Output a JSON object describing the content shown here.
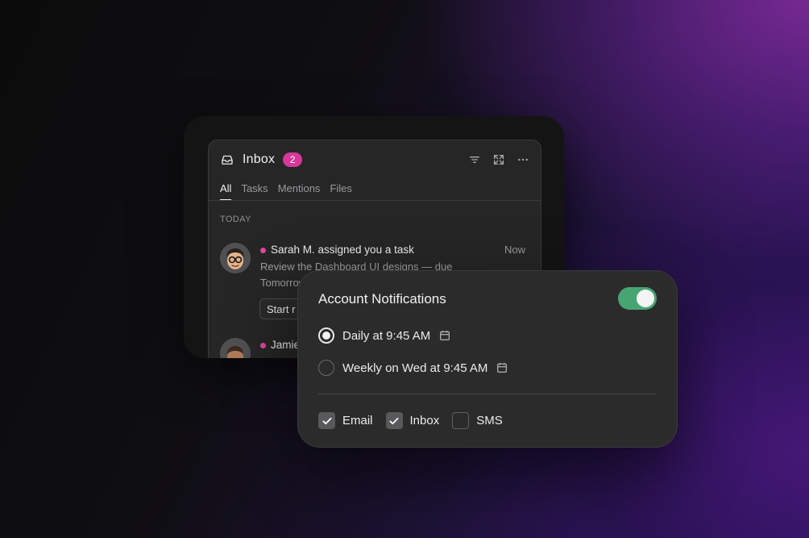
{
  "inbox": {
    "title": "Inbox",
    "badge": "2",
    "tabs": [
      "All",
      "Tasks",
      "Mentions",
      "Files"
    ],
    "active_tab": "All",
    "section": "TODAY",
    "items": [
      {
        "title": "Sarah M. assigned you a task",
        "time": "Now",
        "body_line1": "Review the Dashboard UI designs — due",
        "body_line2": "Tomorrow",
        "action": "Start r"
      },
      {
        "title": "Jamie"
      }
    ]
  },
  "notifications": {
    "title": "Account Notifications",
    "enabled": true,
    "schedule_options": [
      {
        "label": "Daily at 9:45 AM",
        "selected": true
      },
      {
        "label": "Weekly on Wed at 9:45 AM",
        "selected": false
      }
    ],
    "channels": [
      {
        "label": "Email",
        "checked": true
      },
      {
        "label": "Inbox",
        "checked": true
      },
      {
        "label": "SMS",
        "checked": false
      }
    ]
  },
  "colors": {
    "badge": "#d6399a",
    "toggle_on": "#47a574",
    "unread_dot": "#e2459f"
  }
}
